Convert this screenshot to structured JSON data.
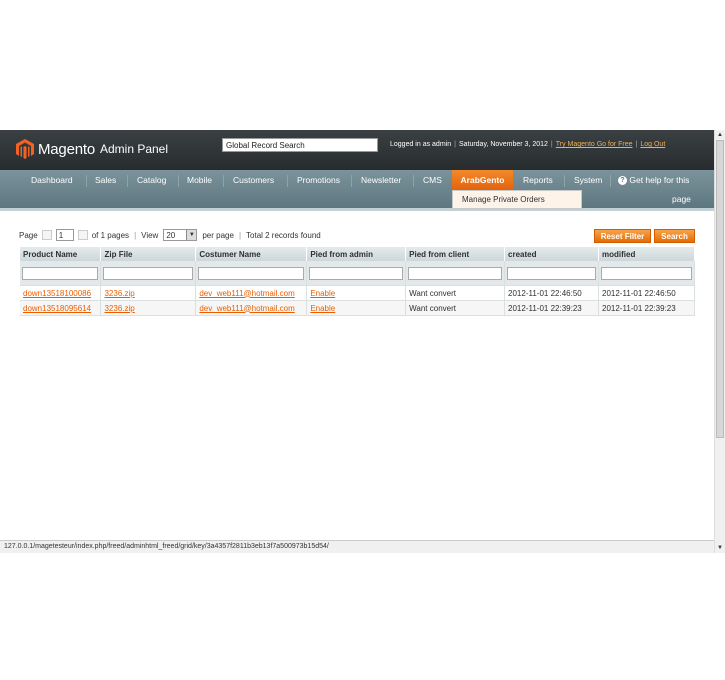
{
  "header": {
    "logo_text": "Magento",
    "logo_sub": "Admin Panel",
    "search_value": "Global Record Search",
    "logged_in": "Logged in as admin",
    "date": "Saturday, November 3, 2012",
    "try_link": "Try Magento Go for Free",
    "logout": "Log Out"
  },
  "nav": {
    "items": [
      "Dashboard",
      "Sales",
      "Catalog",
      "Mobile",
      "Customers",
      "Promotions",
      "Newsletter",
      "CMS",
      "ArabGento",
      "Reports",
      "System"
    ],
    "help_line1": "Get help for this",
    "help_line2": "page",
    "dropdown_item": "Manage Private Orders",
    "accent": "#e96a12"
  },
  "grid": {
    "page_label": "Page",
    "page_value": "1",
    "of_pages": "of 1 pages",
    "view_label": "View",
    "view_value": "20",
    "per_page": "per page",
    "total": "Total 2 records found",
    "reset_filter": "Reset Filter",
    "search": "Search",
    "columns": [
      "Product Name",
      "Zip File",
      "Costumer Name",
      "Pied from admin",
      "Pied from client",
      "created",
      "modified"
    ],
    "rows": [
      [
        "down13518100086",
        "3236.zip",
        "dev_web111@hotmail.com",
        "Enable",
        "Want convert",
        "2012-11-01 22:46:50",
        "2012-11-01 22:46:50"
      ],
      [
        "down13518095614",
        "3236.zip",
        "dev_web111@hotmail.com",
        "Enable",
        "Want convert",
        "2012-11-01 22:39:23",
        "2012-11-01 22:39:23"
      ]
    ]
  },
  "status_bar": "127.0.0.1/magetesteur/index.php/freed/adminhtml_freed/grid/key/3a4357f2811b3eb13f7a500973b15d54/"
}
